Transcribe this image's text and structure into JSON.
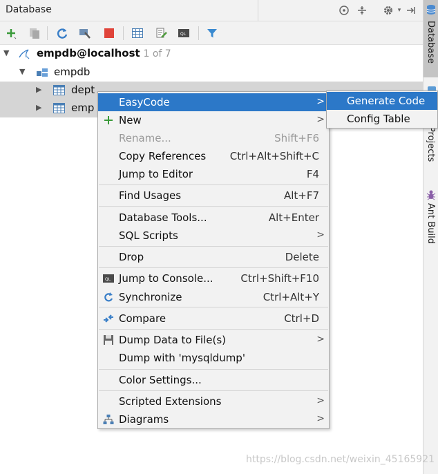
{
  "panel": {
    "title": "Database"
  },
  "header_icons": [
    "crosshair-icon",
    "collapse-icon",
    "gear-icon",
    "hide-icon"
  ],
  "toolbar": [
    "add-icon",
    "copy-icon",
    "refresh-icon",
    "tools-icon",
    "stop-icon",
    "table-icon",
    "edit-icon",
    "console-icon",
    "filter-icon"
  ],
  "tree": {
    "datasource": {
      "label": "empdb@localhost",
      "meta": "1 of 7"
    },
    "schema": {
      "label": "empdb"
    },
    "tables": [
      {
        "label": "dept"
      },
      {
        "label": "emp"
      }
    ]
  },
  "menu": {
    "items": [
      {
        "label": "EasyCode",
        "shortcut": "",
        "submenu": true
      },
      {
        "label": "New",
        "shortcut": "",
        "submenu": true
      },
      {
        "label": "Rename...",
        "shortcut": "Shift+F6"
      },
      {
        "label": "Copy References",
        "shortcut": "Ctrl+Alt+Shift+C"
      },
      {
        "label": "Jump to Editor",
        "shortcut": "F4"
      },
      {
        "label": "Find Usages",
        "shortcut": "Alt+F7"
      },
      {
        "label": "Database Tools...",
        "shortcut": "Alt+Enter"
      },
      {
        "label": "SQL Scripts",
        "shortcut": "",
        "submenu": true
      },
      {
        "label": "Drop",
        "shortcut": "Delete"
      },
      {
        "label": "Jump to Console...",
        "shortcut": "Ctrl+Shift+F10"
      },
      {
        "label": "Synchronize",
        "shortcut": "Ctrl+Alt+Y"
      },
      {
        "label": "Compare",
        "shortcut": "Ctrl+D"
      },
      {
        "label": "Dump Data to File(s)",
        "shortcut": "",
        "submenu": true
      },
      {
        "label": "Dump with 'mysqldump'",
        "shortcut": ""
      },
      {
        "label": "Color Settings...",
        "shortcut": ""
      },
      {
        "label": "Scripted Extensions",
        "shortcut": "",
        "submenu": true
      },
      {
        "label": "Diagrams",
        "shortcut": "",
        "submenu": true
      }
    ],
    "submenu_arrow": ">"
  },
  "submenu": {
    "items": [
      {
        "label": "Generate Code"
      },
      {
        "label": "Config Table"
      }
    ]
  },
  "side_tabs": {
    "database": "Database",
    "projects": "Projects",
    "ant": "Ant Build"
  },
  "watermark": "https://blog.csdn.net/weixin_45165921",
  "colors": {
    "highlight": "#2c78c8",
    "selection": "#d5d5d5"
  }
}
